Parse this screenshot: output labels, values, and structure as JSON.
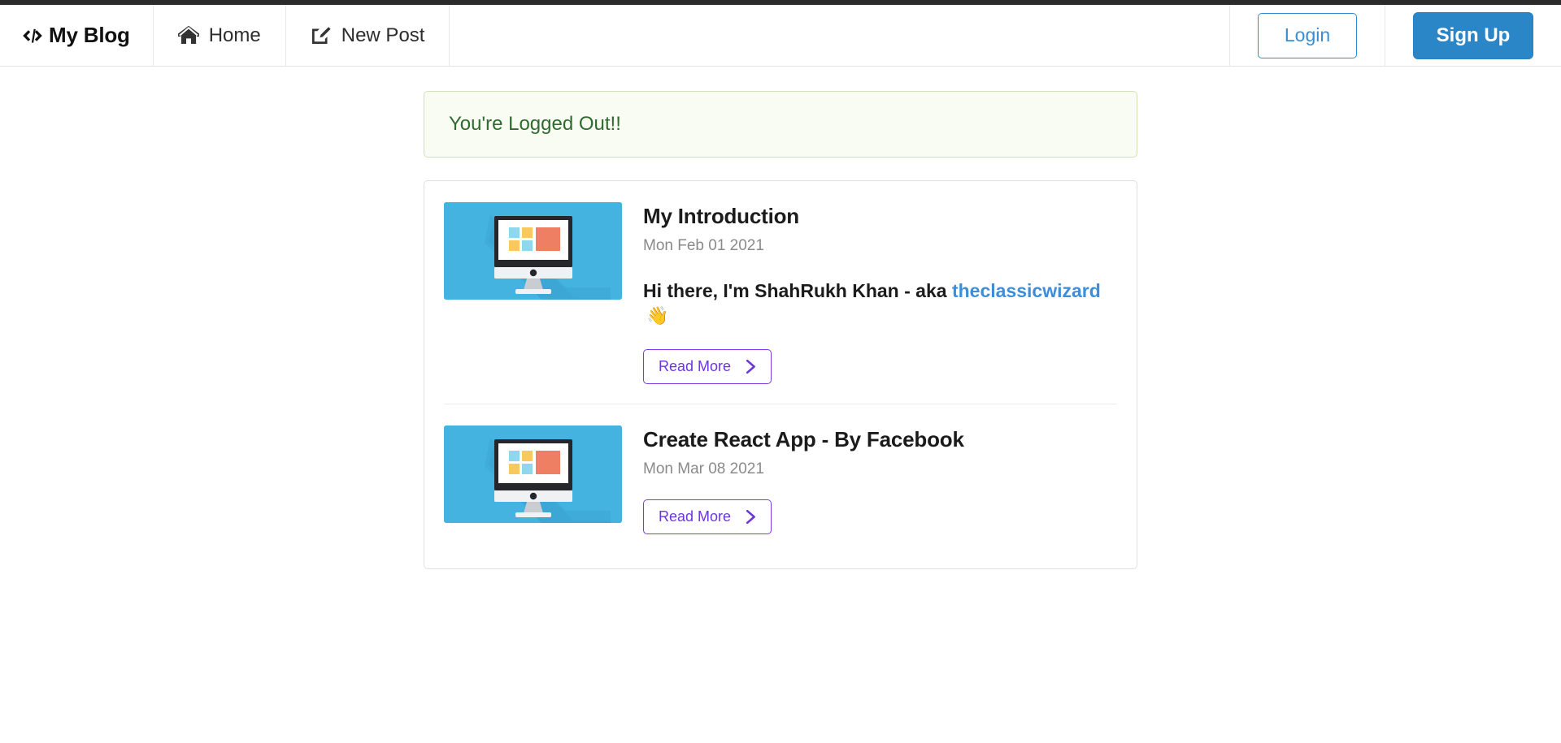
{
  "navbar": {
    "brand": {
      "icon": "code-icon",
      "label": "My Blog"
    },
    "items": [
      {
        "icon": "home-icon",
        "label": "Home"
      },
      {
        "icon": "pen-square-icon",
        "label": "New Post"
      }
    ],
    "auth": {
      "login_label": "Login",
      "signup_label": "Sign Up",
      "login_color": "#3a8ed0",
      "signup_bg": "#2b86c8"
    }
  },
  "alert": {
    "message": "You're Logged Out!!",
    "text_color": "#2f6b2f",
    "bg_color": "#f8fcf2",
    "border_color": "#cfe3b8"
  },
  "posts": [
    {
      "title": "My Introduction",
      "date": "Mon Feb 01 2021",
      "excerpt_prefix": "Hi there, I'm ShahRukh Khan - aka ",
      "excerpt_link": "theclassicwizard",
      "excerpt_emoji": "👋",
      "read_more_label": "Read More",
      "thumb_icon": "desktop-monitor-icon",
      "thumb_bg": "#45b3e0"
    },
    {
      "title": "Create React App - By Facebook",
      "date": "Mon Mar 08 2021",
      "excerpt_prefix": "",
      "excerpt_link": "",
      "excerpt_emoji": "",
      "read_more_label": "Read More",
      "thumb_icon": "desktop-monitor-icon",
      "thumb_bg": "#45b3e0"
    }
  ],
  "theme": {
    "read_more_accent": "#6d36d8",
    "link_blue": "#3d8ed6"
  }
}
